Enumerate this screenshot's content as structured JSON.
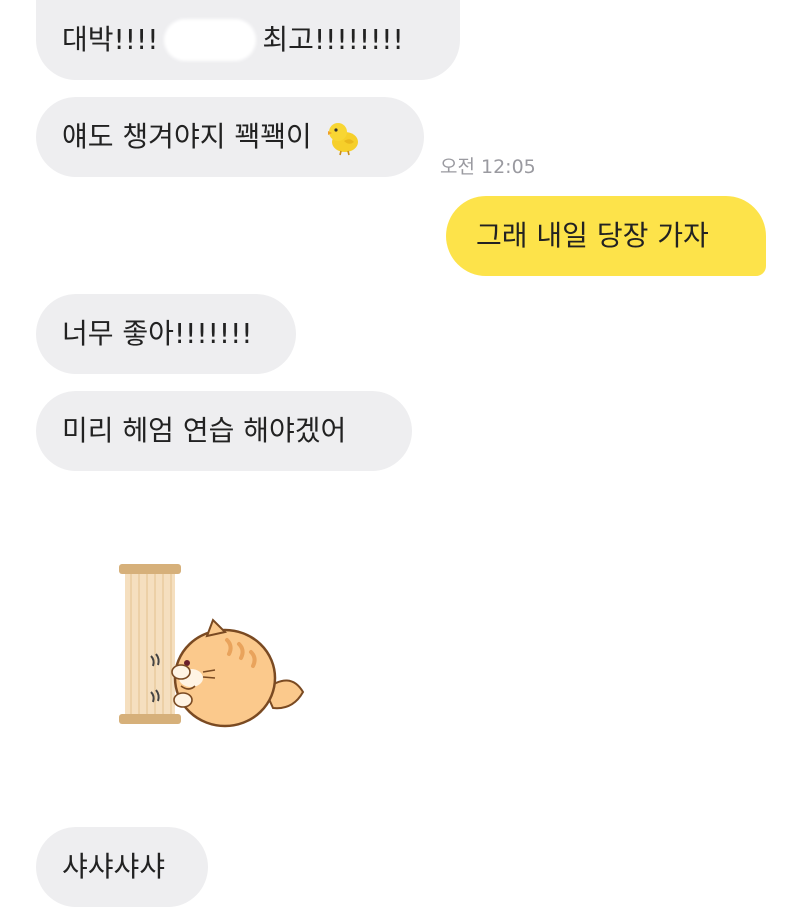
{
  "chat": {
    "messages": [
      {
        "side": "received",
        "before_redaction": "대박!!!!",
        "after_redaction": "최고!!!!!!!!"
      },
      {
        "side": "received",
        "text": "얘도 챙겨야지 꽥꽥이",
        "emoji": "chick-icon"
      },
      {
        "side": "sent",
        "text": "그래 내일 당장 가자"
      },
      {
        "side": "received",
        "text": "너무 좋아!!!!!!!"
      },
      {
        "side": "received",
        "text": "미리 헤엄 연습 해야겠어"
      },
      {
        "side": "received",
        "sticker": "cat-scratching-post-sticker"
      },
      {
        "side": "received",
        "text": "샤샤샤샤"
      }
    ],
    "timestamp": "오전 12:05"
  },
  "colors": {
    "received_bubble": "#eeeef0",
    "sent_bubble": "#fde34a",
    "text": "#222222",
    "timestamp": "#9a9aa0"
  }
}
